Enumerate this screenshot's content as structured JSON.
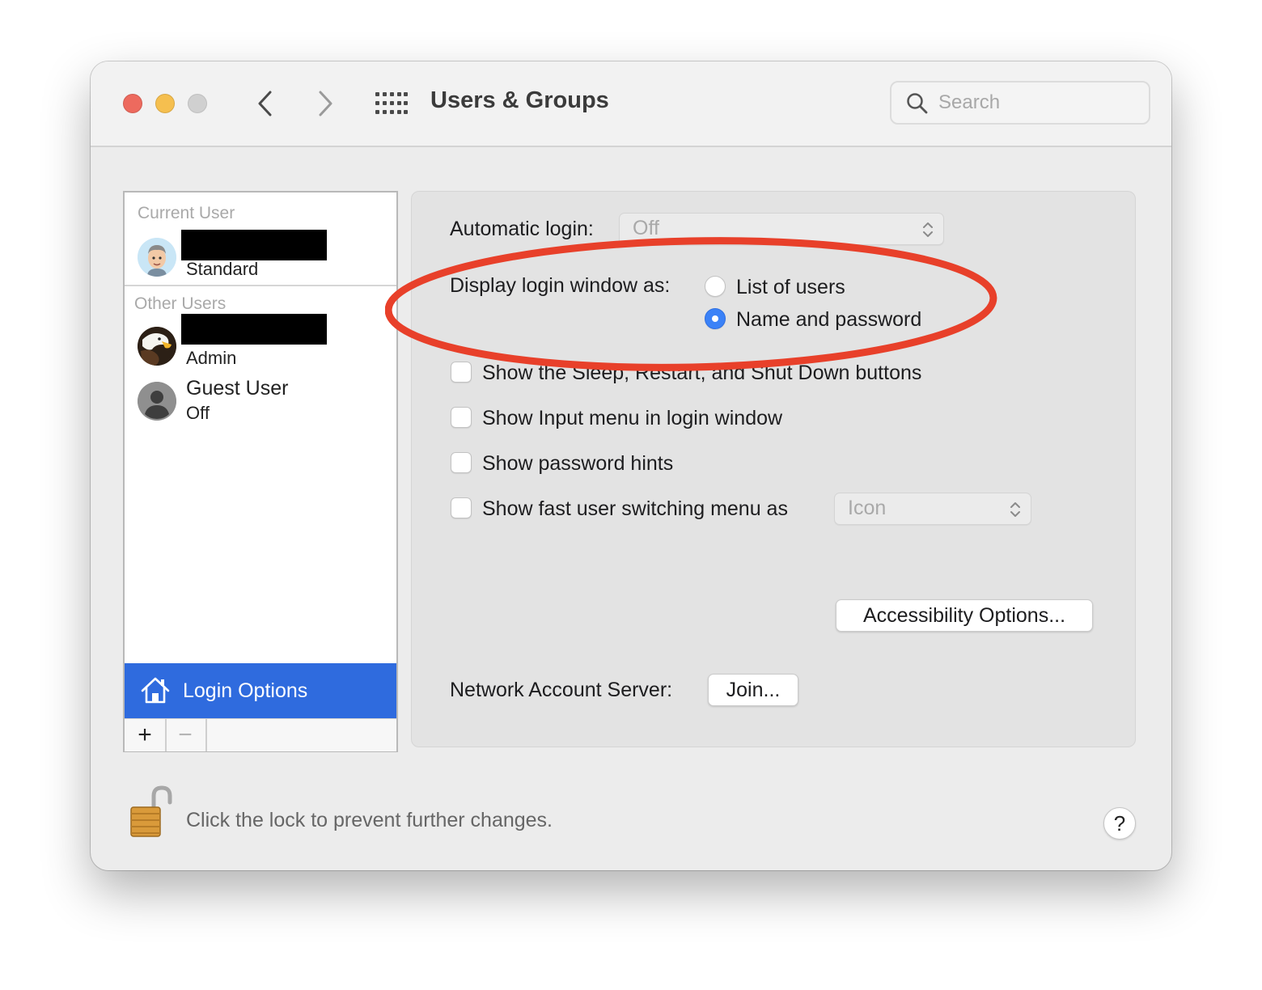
{
  "window": {
    "title": "Users & Groups",
    "search_placeholder": "Search"
  },
  "sidebar": {
    "current_user_label": "Current User",
    "current_user": {
      "role": "Standard",
      "name_redacted": true
    },
    "other_users_label": "Other Users",
    "other_users": [
      {
        "role": "Admin",
        "name_redacted": true,
        "avatar": "eagle-avatar"
      },
      {
        "name": "Guest User",
        "status": "Off",
        "avatar": "guest-silhouette-avatar"
      }
    ],
    "login_options_label": "Login Options",
    "add_label": "+",
    "remove_label": "−"
  },
  "login_options": {
    "automatic_login_label": "Automatic login:",
    "automatic_login_value": "Off",
    "display_login_label": "Display login window as:",
    "radio_options": [
      {
        "label": "List of users",
        "selected": false
      },
      {
        "label": "Name and password",
        "selected": true
      }
    ],
    "checkboxes": [
      {
        "label": "Show the Sleep, Restart, and Shut Down buttons",
        "checked": false
      },
      {
        "label": "Show Input menu in login window",
        "checked": false
      },
      {
        "label": "Show password hints",
        "checked": false
      },
      {
        "label": "Show fast user switching menu as",
        "checked": false
      }
    ],
    "fast_switch_value": "Icon",
    "accessibility_button": "Accessibility Options...",
    "network_server_label": "Network Account Server:",
    "join_button": "Join..."
  },
  "footer": {
    "lock_text": "Click the lock to prevent further changes.",
    "help_label": "?"
  },
  "annotation": {
    "type": "red-ellipse",
    "color": "#e8402a"
  }
}
